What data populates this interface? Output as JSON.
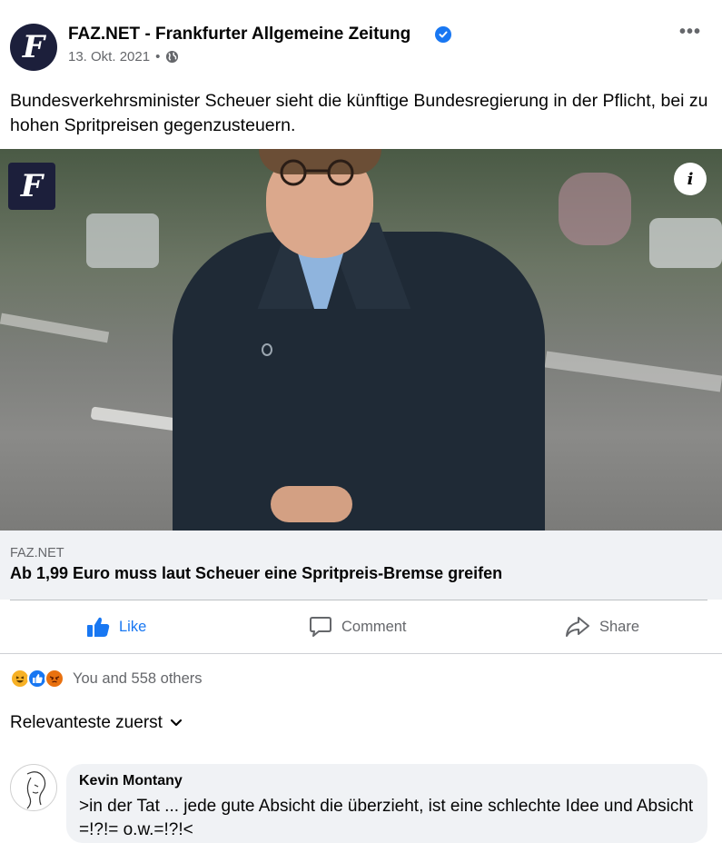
{
  "header": {
    "logo_letter": "F",
    "page_name": "FAZ.NET - Frankfurter Allgemeine Zeitung",
    "date": "13. Okt. 2021",
    "separator": "•",
    "more": "•••"
  },
  "post": {
    "text": "Bundesverkehrsminister Scheuer sieht die künftige Bundesregierung in der Pflicht, bei zu hohen Spritpreisen gegenzusteuern."
  },
  "media": {
    "logo_letter": "F",
    "info_label": "i"
  },
  "link": {
    "domain": "FAZ.NET",
    "title": "Ab 1,99 Euro muss laut Scheuer eine Spritpreis-Bremse greifen"
  },
  "actions": {
    "like": "Like",
    "comment": "Comment",
    "share": "Share"
  },
  "reactions": {
    "summary": "You and 558 others",
    "icons": [
      "haha",
      "like",
      "angry"
    ]
  },
  "sort": {
    "label": "Relevanteste zuerst"
  },
  "comment": {
    "author": "Kevin Montany",
    "text": ">in der Tat ... jede gute Absicht die überzieht, ist eine schlechte Idee und Absicht =!?!= o.w.=!?!<"
  },
  "colors": {
    "accent": "#1877f2",
    "secondary_text": "#65676b",
    "card_bg": "#f0f2f5",
    "logo_bg": "#1c1f3b"
  }
}
